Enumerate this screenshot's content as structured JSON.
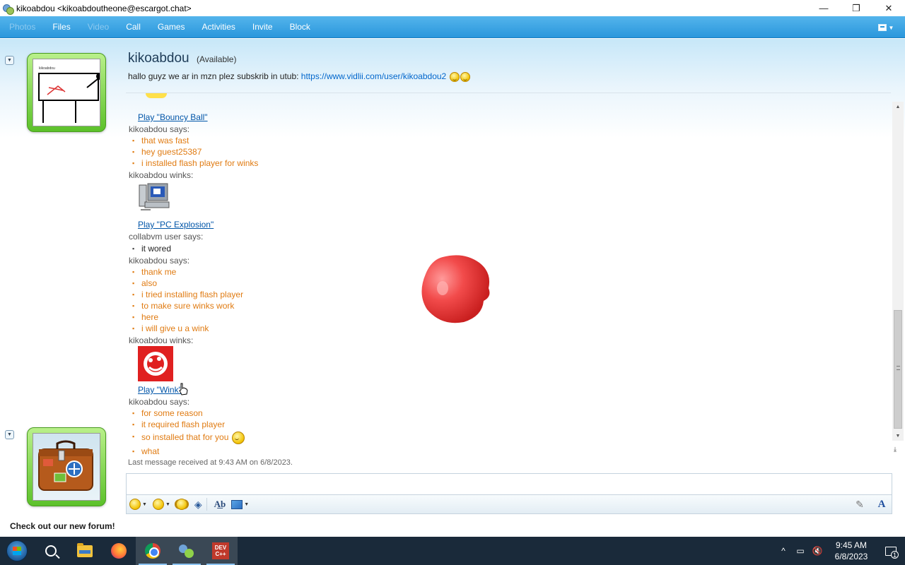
{
  "window": {
    "title": "kikoabdou <kikoabdoutheone@escargot.chat>",
    "controls": {
      "minimize": "—",
      "restore": "❐",
      "close": "✕"
    }
  },
  "menu": {
    "items": [
      {
        "label": "Photos",
        "enabled": false
      },
      {
        "label": "Files",
        "enabled": true
      },
      {
        "label": "Video",
        "enabled": false
      },
      {
        "label": "Call",
        "enabled": true
      },
      {
        "label": "Games",
        "enabled": true
      },
      {
        "label": "Activities",
        "enabled": true
      },
      {
        "label": "Invite",
        "enabled": true
      },
      {
        "label": "Block",
        "enabled": true
      }
    ]
  },
  "contact": {
    "name": "kikoabdou",
    "status": "(Available)",
    "personal_message": "hallo guyz we ar in mzn plez subskrib in utub: ",
    "personal_link": "https://www.vidlii.com/user/kikoabdou2"
  },
  "conversation": {
    "wink1_play": "Play \"Bouncy Ball\"",
    "sender1": "kikoabdou says:",
    "msgs1": [
      "that was fast",
      "hey guest25387",
      "i installed flash player for winks"
    ],
    "sender2": "kikoabdou winks:",
    "wink2_play": "Play \"PC Explosion\"",
    "sender3": "collabvm user says:",
    "msgs3": [
      "it wored"
    ],
    "sender4": "kikoabdou says:",
    "msgs4": [
      "thank me",
      "also",
      "i tried installing flash player",
      "to make sure winks work",
      "here",
      "i will give u a wink"
    ],
    "sender5": "kikoabdou winks:",
    "wink3_play": "Play \"Wink\"",
    "sender6": "kikoabdou says:",
    "msgs6": [
      "for some reason",
      "it required flash player",
      "so installed that for you",
      "what"
    ],
    "last_received": "Last message received at 9:43 AM on 6/8/2023."
  },
  "footer": {
    "forum_text": "Check out our new forum!"
  },
  "taskbar": {
    "dev_label_1": "DEV",
    "dev_label_2": "C++",
    "time": "9:45 AM",
    "date": "6/8/2023",
    "notifications": "1"
  },
  "colors": {
    "menubar": "#2a97dc",
    "own_message": "#e07b12",
    "link": "#0055a8",
    "avatar_frame": "#5cc12a"
  }
}
